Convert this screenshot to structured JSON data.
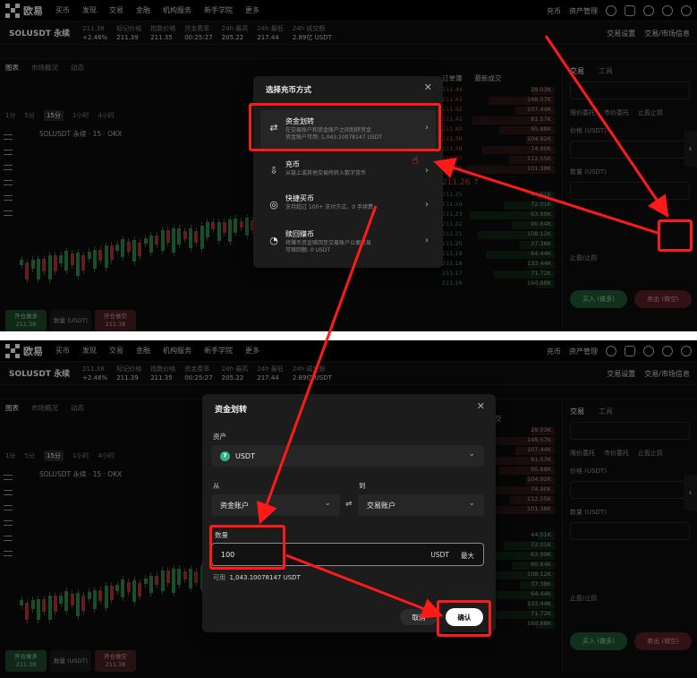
{
  "colors": {
    "annotation": "#ff1a1a",
    "up": "#32a35a",
    "down": "#d24b4b",
    "usdt": "#2db48a"
  },
  "nav": {
    "brand": "欧易",
    "items": [
      "买币",
      "发现",
      "交易",
      "金融",
      "机构服务",
      "新手学院",
      "更多"
    ],
    "right": [
      "充币",
      "资产管理"
    ]
  },
  "symbol": {
    "name": "SOLUSDT 永续",
    "stats": [
      {
        "label": "211.38",
        "value": "+2.46%"
      },
      {
        "label": "标记价格",
        "value": "211.39"
      },
      {
        "label": "指数价格",
        "value": "211.35"
      },
      {
        "label": "资金费率",
        "value": "00:25:27"
      },
      {
        "label": "24h 最高",
        "value": "205.22"
      },
      {
        "label": "24h 最低",
        "value": "217.44"
      },
      {
        "label": "24h 成交额",
        "value": "2.89亿 USDT"
      }
    ],
    "right": [
      "交易设置",
      "交易/市场信息"
    ]
  },
  "chart_tabs": [
    "图表",
    "市场概况",
    "动态"
  ],
  "timeframes": [
    "1分",
    "5分",
    "15分",
    "1小时",
    "4小时"
  ],
  "chart_label": "SOLUSDT 永续 · 15 · OKX",
  "orderbook": {
    "tabs": [
      "订单簿",
      "最新成交"
    ],
    "asks": [
      {
        "p": "211.44",
        "q": "29.03K"
      },
      {
        "p": "211.43",
        "q": "148.57K"
      },
      {
        "p": "211.42",
        "q": "107.44K"
      },
      {
        "p": "211.41",
        "q": "81.57K"
      },
      {
        "p": "211.40",
        "q": "95.88K"
      },
      {
        "p": "211.39",
        "q": "104.92K"
      },
      {
        "p": "211.38",
        "q": "74.90K"
      },
      {
        "p": "211.37",
        "q": "112.55K"
      },
      {
        "p": "211.36",
        "q": "101.38K"
      }
    ],
    "mid": "211.26 ↑",
    "bids": [
      {
        "p": "211.25",
        "q": "44.51K"
      },
      {
        "p": "211.24",
        "q": "72.01K"
      },
      {
        "p": "211.23",
        "q": "63.99K"
      },
      {
        "p": "211.22",
        "q": "90.64K"
      },
      {
        "p": "211.21",
        "q": "108.12K"
      },
      {
        "p": "211.20",
        "q": "37.38K"
      },
      {
        "p": "211.19",
        "q": "64.44K"
      },
      {
        "p": "211.18",
        "q": "133.44K"
      },
      {
        "p": "211.17",
        "q": "71.72K"
      },
      {
        "p": "211.16",
        "q": "160.68K"
      }
    ]
  },
  "trade_panel": {
    "tabs": [
      "交易",
      "工具"
    ],
    "order_types": [
      "限价委托",
      "市价委托",
      "止盈止损"
    ],
    "price_label": "价格 (USDT)",
    "qty_label": "数量 (USDT)",
    "tp_label": "止盈/止损",
    "buy": "买入 (做多)",
    "sell": "卖出 (做空)"
  },
  "bottom_buttons": [
    {
      "label": "开仓做多",
      "value": "211.38"
    },
    {
      "label": "数量 (USDT)",
      "value": ""
    },
    {
      "label": "开仓做空",
      "value": "211.38"
    }
  ],
  "select_modal": {
    "title": "选择充币方式",
    "close": "✕",
    "options": [
      {
        "icon": "⇄",
        "title": "资金划转",
        "desc": "在交易账户和资金账户之间划转资金",
        "desc2": "资金账户可用: 1,043.10078147 USDT"
      },
      {
        "icon": "⇩",
        "title": "充币",
        "desc": "从链上或其他交易所转入数字货币",
        "desc2": ""
      },
      {
        "icon": "◎",
        "title": "快捷买币",
        "desc": "支持超过 100+ 支付方式，0 手续费",
        "desc2": ""
      },
      {
        "icon": "◔",
        "title": "赎回赚币",
        "desc": "将赚币资金赎回至交易账户以便交易",
        "desc2": "可赎回额: 0 USDT"
      }
    ]
  },
  "transfer_modal": {
    "title": "资金划转",
    "close": "✕",
    "asset_label": "资产",
    "asset_value": "USDT",
    "from_label": "从",
    "from_value": "资金账户",
    "to_label": "到",
    "to_value": "交易账户",
    "swap_icon": "⇌",
    "amount_label": "数量",
    "amount_value": "100",
    "amount_unit": "USDT",
    "max_label": "最大",
    "available_label": "可用",
    "available_value": "1,043.10078147 USDT",
    "cancel": "取消",
    "confirm": "确认"
  }
}
